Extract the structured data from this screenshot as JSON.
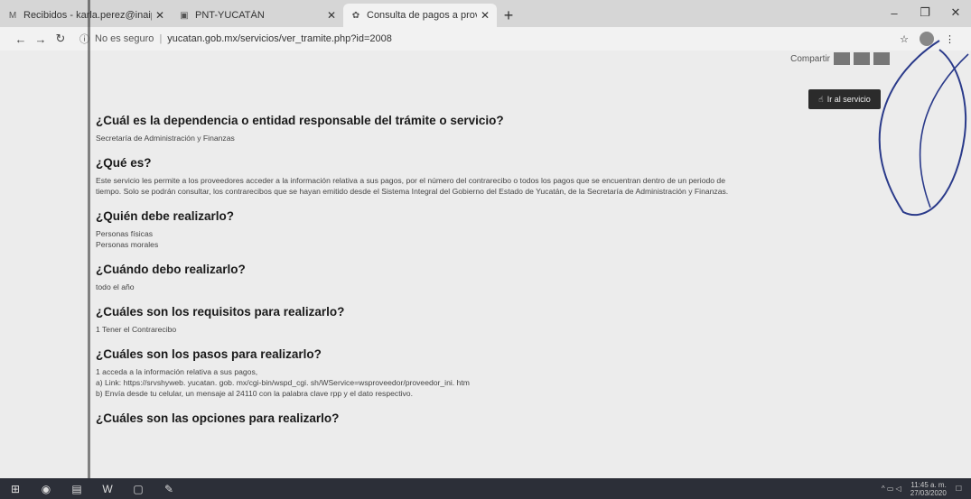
{
  "tabs": [
    {
      "icon": "gmail-icon",
      "title": "Recibidos - karla.perez@inaipyu",
      "active": false
    },
    {
      "icon": "pnt-icon",
      "title": "PNT-YUCATÁN",
      "active": false
    },
    {
      "icon": "yucatan-icon",
      "title": "Consulta de pagos a proveedore",
      "active": true
    }
  ],
  "toolbar": {
    "security": "No es seguro",
    "url": "yucatan.gob.mx/servicios/ver_tramite.php?id=2008"
  },
  "share": {
    "label": "Compartir"
  },
  "go_button": {
    "label": "Ir al servicio"
  },
  "sections": [
    {
      "question": "¿Cuál es la dependencia o entidad responsable del trámite o servicio?",
      "lines": [
        "Secretaría de Administración y Finanzas"
      ]
    },
    {
      "question": "¿Qué es?",
      "lines": [
        "Este servicio les permite a los proveedores acceder a la información relativa a sus pagos, por el número del contrarecibo o todos los pagos que se encuentran dentro de un periodo de",
        "tiempo. Solo se podrán consultar, los contrarecibos que se hayan emitido desde el Sistema Integral del Gobierno del Estado de Yucatán, de la Secretaría de Administración y Finanzas."
      ]
    },
    {
      "question": "¿Quién debe realizarlo?",
      "lines": [
        "Personas físicas",
        "Personas morales"
      ]
    },
    {
      "question": "¿Cuándo debo realizarlo?",
      "lines": [
        "todo el año"
      ]
    },
    {
      "question": "¿Cuáles son los requisitos para realizarlo?",
      "lines": [
        "1 Tener el Contrarecibo"
      ]
    },
    {
      "question": "¿Cuáles son los pasos para realizarlo?",
      "lines": [
        "1 acceda a la información relativa a sus pagos,",
        "a) Link: https://srvshyweb. yucatan. gob. mx/cgi-bin/wspd_cgi. sh/WService=wsproveedor/proveedor_ini. htm",
        "b) Envía desde tu celular, un mensaje al 24110 con la palabra clave rpp y el dato respectivo."
      ]
    },
    {
      "question": "¿Cuáles son las opciones para realizarlo?",
      "lines": []
    }
  ],
  "taskbar": {
    "time": "11:45 a. m.",
    "date": "27/03/2020"
  },
  "colors": {
    "taskbar": "#2c2f38",
    "button": "#2b2b2b"
  }
}
